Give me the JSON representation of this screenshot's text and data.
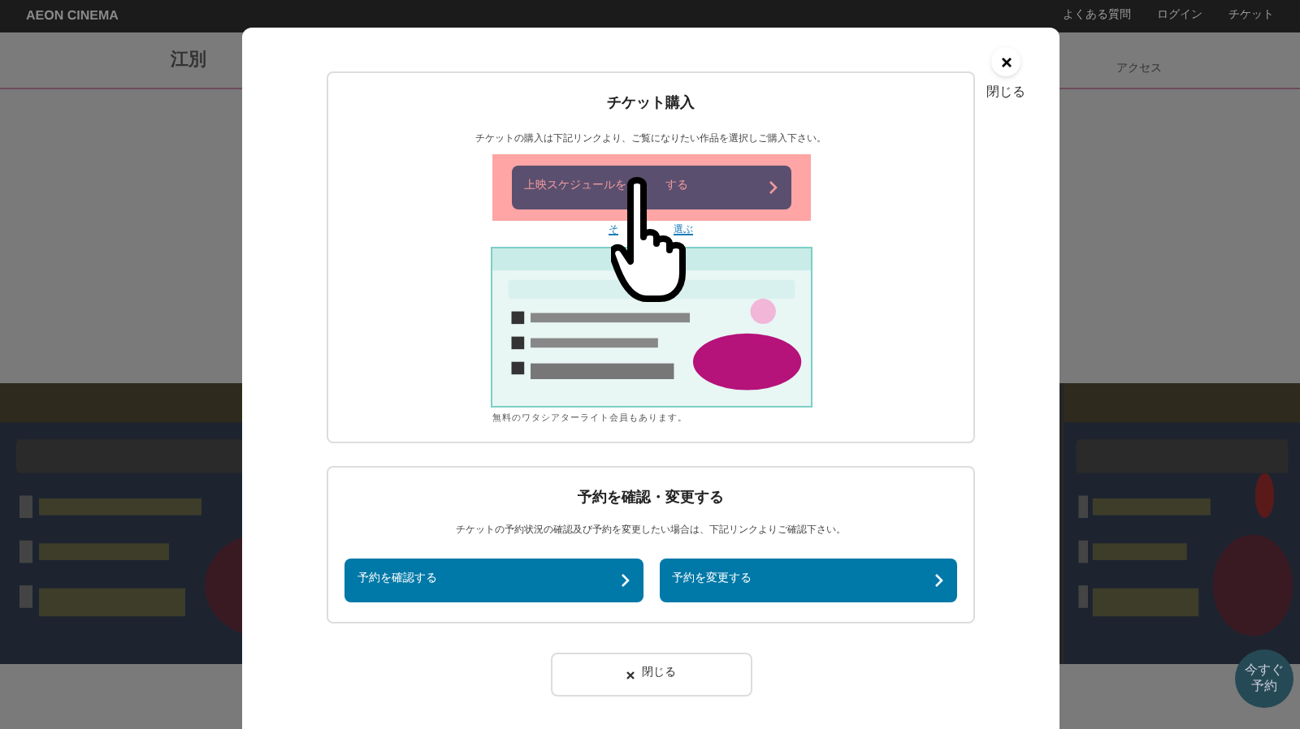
{
  "header": {
    "logo": "AEON CINEMA",
    "links": [
      "よくある質問",
      "ログイン",
      "チケット"
    ]
  },
  "nav": {
    "theater": "江別",
    "access": "アクセス"
  },
  "float_button": "今すぐ予約",
  "modal": {
    "close_label": "閉じる",
    "purchase": {
      "title": "チケット購入",
      "description": "チケットの購入は下記リンクより、ご覧になりたい作品を選択しご購入下さい。",
      "button": [
        "上映スケジュールを",
        "する"
      ],
      "highlighted": true,
      "link": [
        "そ",
        "選ぶ"
      ],
      "note": "無料のワタシアターライト会員もあります。"
    },
    "reservation": {
      "title": "予約を確認・変更する",
      "description": "チケットの予約状況の確認及び予約を変更したい場合は、下記リンクよりご確認下さい。",
      "buttons": [
        "予約を確認する",
        "予約を変更する"
      ]
    },
    "footer_button": "閉じる"
  }
}
